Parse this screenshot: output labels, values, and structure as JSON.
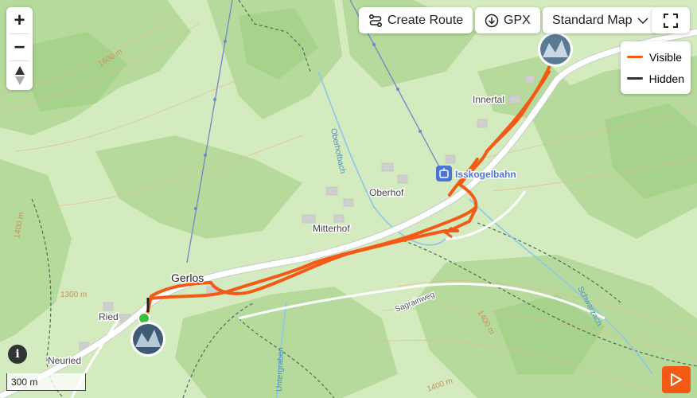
{
  "toolbar": {
    "create_route_label": "Create Route",
    "gpx_label": "GPX",
    "map_style_label": "Standard Map"
  },
  "zoom": {
    "in_label": "+",
    "out_label": "−"
  },
  "legend": {
    "items": [
      {
        "label": "Visible",
        "color": "#f25a16"
      },
      {
        "label": "Hidden",
        "color": "#333333"
      }
    ]
  },
  "map_labels": {
    "gerlos": "Gerlos",
    "ried": "Ried",
    "neuried": "Neuried",
    "mitterhof": "Mitterhof",
    "oberhof": "Oberhof",
    "innertal": "Innertal",
    "isskogelbahn": "Isskogelbahn",
    "oberhofbach": "Oberhofbach",
    "sagrainweg": "Sagrainweg",
    "schwarzach": "Schwarzach",
    "untergraben": "Untergraben",
    "contour_1600": "1600 m",
    "contour_1400": "1400 m",
    "contour_1300": "1300 m",
    "contour_1400b": "1400 m",
    "contour_1400c": "1400 m"
  },
  "info_label": "i",
  "scale_label": "300 m",
  "colors": {
    "route": "#f25a16",
    "accent": "#4a74d6",
    "road": "#ffffff",
    "forest": "#b4d99a",
    "meadow": "#d6ecc4"
  }
}
